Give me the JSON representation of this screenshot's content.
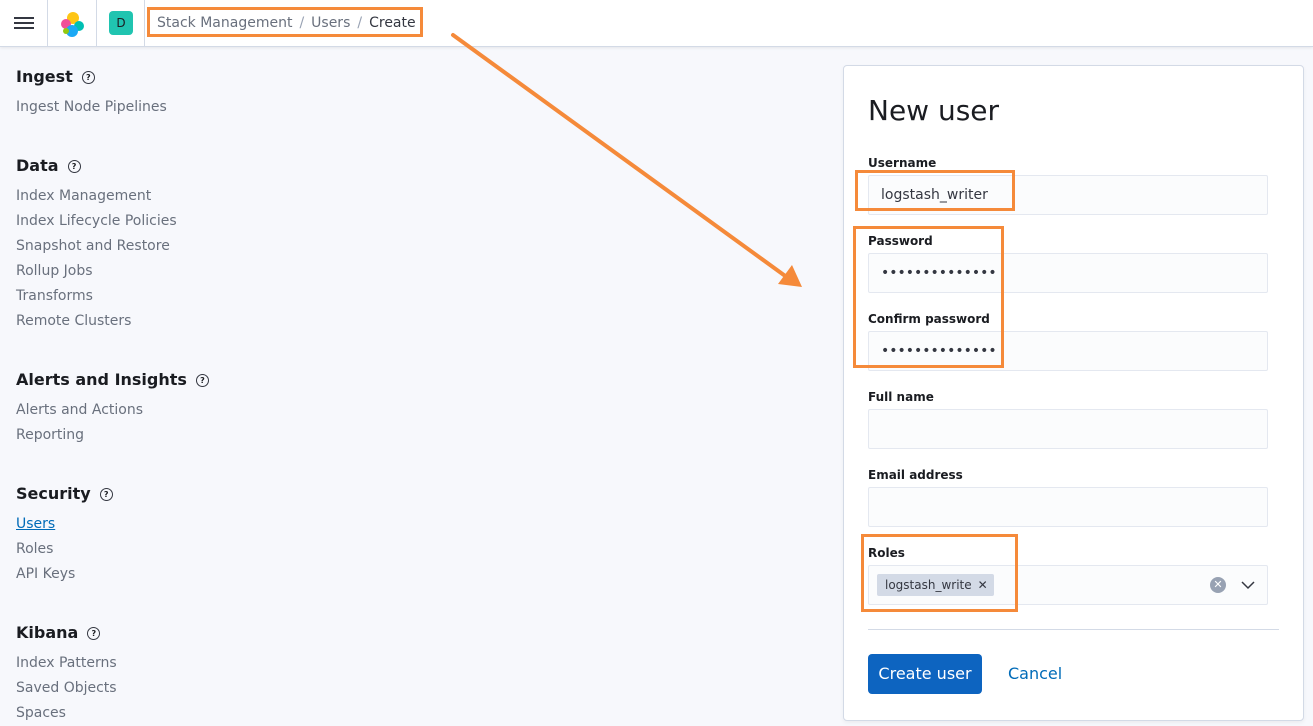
{
  "header": {
    "space_initial": "D",
    "breadcrumbs": [
      "Stack Management",
      "Users",
      "Create"
    ]
  },
  "sidebar": {
    "sections": [
      {
        "title": "Ingest",
        "items": [
          "Ingest Node Pipelines"
        ]
      },
      {
        "title": "Data",
        "items": [
          "Index Management",
          "Index Lifecycle Policies",
          "Snapshot and Restore",
          "Rollup Jobs",
          "Transforms",
          "Remote Clusters"
        ]
      },
      {
        "title": "Alerts and Insights",
        "items": [
          "Alerts and Actions",
          "Reporting"
        ]
      },
      {
        "title": "Security",
        "items": [
          "Users",
          "Roles",
          "API Keys"
        ]
      },
      {
        "title": "Kibana",
        "items": [
          "Index Patterns",
          "Saved Objects",
          "Spaces"
        ]
      }
    ],
    "active_item": "Users"
  },
  "form": {
    "title": "New user",
    "username_label": "Username",
    "username_value": "logstash_writer",
    "password_label": "Password",
    "password_value": "••••••••••••••",
    "confirm_label": "Confirm password",
    "confirm_value": "••••••••••••••",
    "fullname_label": "Full name",
    "fullname_value": "",
    "email_label": "Email address",
    "email_value": "",
    "roles_label": "Roles",
    "roles": [
      "logstash_write"
    ],
    "submit_label": "Create user",
    "cancel_label": "Cancel"
  },
  "colors": {
    "accent": "#006bb8",
    "primary_button": "#0d64c0",
    "annotation": "#f58a3a",
    "space_avatar": "#20c4b0"
  }
}
